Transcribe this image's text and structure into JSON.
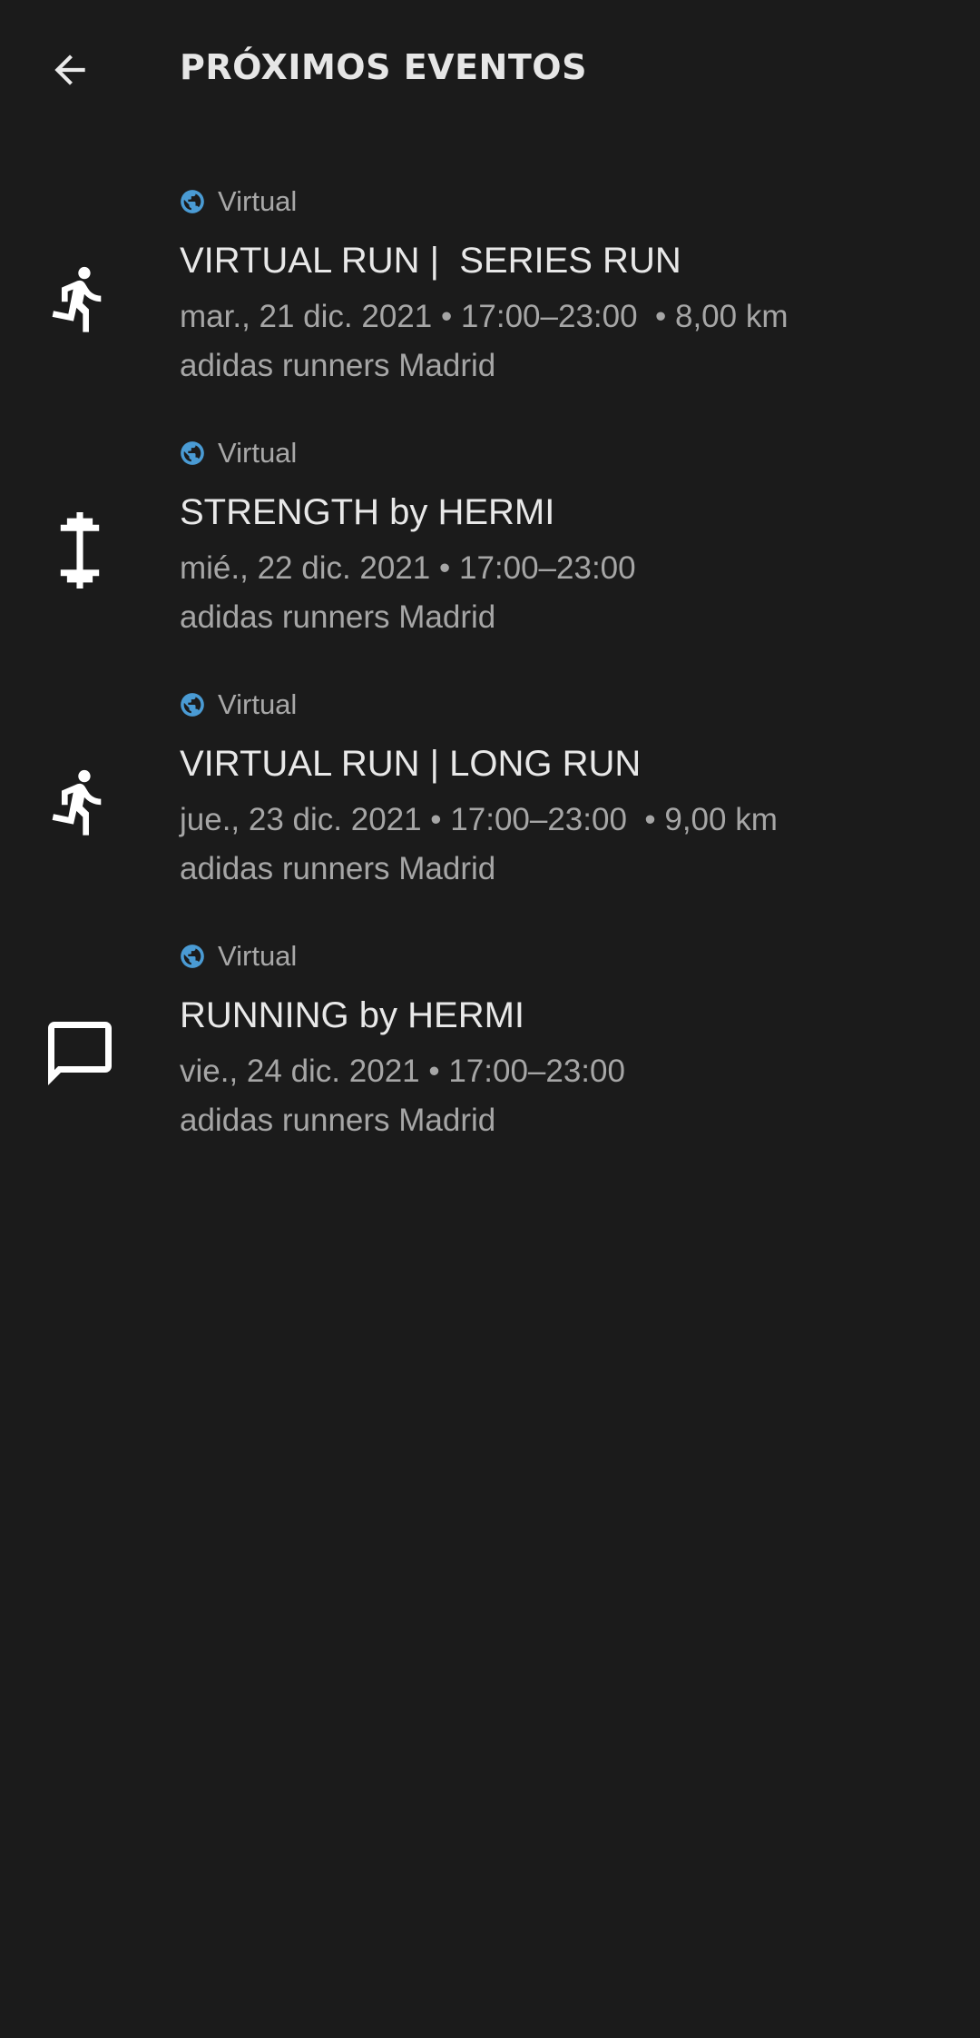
{
  "header": {
    "title": "PRÓXIMOS EVENTOS",
    "back_icon": "arrow-left-icon"
  },
  "colors": {
    "background": "#1b1b1b",
    "globe_accent": "#4a9bd4"
  },
  "events": [
    {
      "icon": "running-person-icon",
      "location": "Virtual",
      "title": "VIRTUAL RUN |  SERIES RUN",
      "meta": "mar., 21 dic. 2021 • 17:00–23:00  • 8,00 km",
      "organizer": "adidas runners Madrid"
    },
    {
      "icon": "dumbbell-icon",
      "location": "Virtual",
      "title": "STRENGTH by HERMI",
      "meta": "mié., 22 dic. 2021 • 17:00–23:00",
      "organizer": "adidas runners Madrid"
    },
    {
      "icon": "running-person-icon",
      "location": "Virtual",
      "title": "VIRTUAL RUN | LONG RUN",
      "meta": "jue., 23 dic. 2021 • 17:00–23:00  • 9,00 km",
      "organizer": "adidas runners Madrid"
    },
    {
      "icon": "chat-bubble-icon",
      "location": "Virtual",
      "title": "RUNNING by HERMI",
      "meta": "vie., 24 dic. 2021 • 17:00–23:00",
      "organizer": "adidas runners Madrid"
    }
  ]
}
